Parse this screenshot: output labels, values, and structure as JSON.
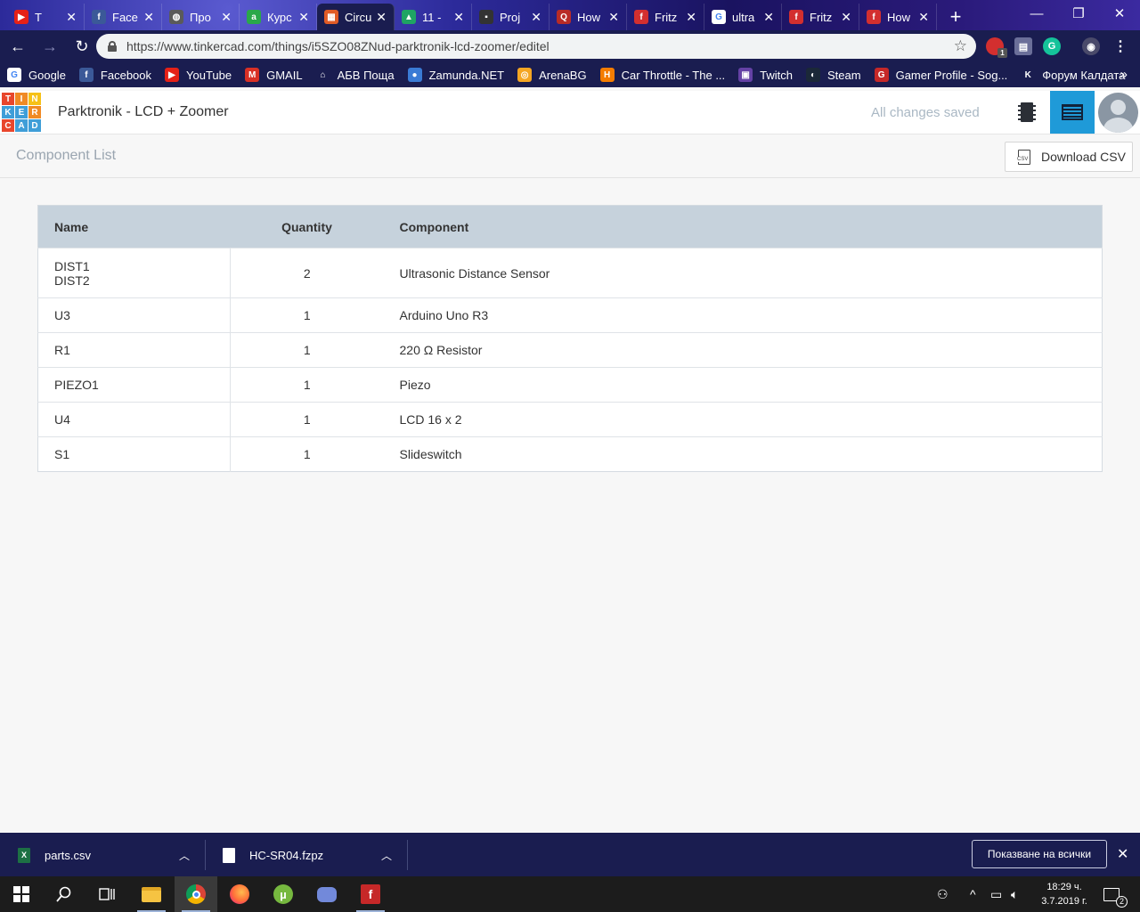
{
  "browser": {
    "tabs": [
      {
        "title": "T",
        "fav_color": "#e62117",
        "fav_glyph": "▶"
      },
      {
        "title": "Face",
        "fav_color": "#3b5998",
        "fav_glyph": "f"
      },
      {
        "title": "Про",
        "fav_color": "#5a5a5a",
        "fav_glyph": "◍"
      },
      {
        "title": "Курс",
        "fav_color": "#2aa84a",
        "fav_glyph": "a"
      },
      {
        "title": "Circu",
        "fav_color": "#e05b26",
        "fav_glyph": "▦"
      },
      {
        "title": "11 -",
        "fav_color": "#1fa463",
        "fav_glyph": "▲"
      },
      {
        "title": "Proj",
        "fav_color": "#333333",
        "fav_glyph": "▪"
      },
      {
        "title": "How",
        "fav_color": "#b92b27",
        "fav_glyph": "Q"
      },
      {
        "title": "Fritz",
        "fav_color": "#d32f2f",
        "fav_glyph": "f"
      },
      {
        "title": "ultra",
        "fav_color": "#ffffff",
        "fav_glyph": "G"
      },
      {
        "title": "Fritz",
        "fav_color": "#d32f2f",
        "fav_glyph": "f"
      },
      {
        "title": "How",
        "fav_color": "#d32f2f",
        "fav_glyph": "f"
      }
    ],
    "active_tab_index": 4,
    "url": "https://www.tinkercad.com/things/i5SZO08ZNud-parktronik-lcd-zoomer/editel",
    "extension_badge": "1",
    "bookmarks": [
      {
        "label": "Google",
        "icon": "google-icon",
        "color": "#ffffff",
        "glyph": "G"
      },
      {
        "label": "Facebook",
        "icon": "facebook-icon",
        "color": "#3b5998",
        "glyph": "f"
      },
      {
        "label": "YouTube",
        "icon": "youtube-icon",
        "color": "#e62117",
        "glyph": "▶"
      },
      {
        "label": "GMAIL",
        "icon": "gmail-icon",
        "color": "#d93025",
        "glyph": "M"
      },
      {
        "label": "АБВ Поща",
        "icon": "abv-icon",
        "color": "#1a1d50",
        "glyph": "⌂"
      },
      {
        "label": "Zamunda.NET",
        "icon": "zamunda-icon",
        "color": "#3a7bd5",
        "glyph": "●"
      },
      {
        "label": "ArenaBG",
        "icon": "arenabg-icon",
        "color": "#f5a623",
        "glyph": "◎"
      },
      {
        "label": "Car Throttle - The ...",
        "icon": "carthrottle-icon",
        "color": "#f57c00",
        "glyph": "H"
      },
      {
        "label": "Twitch",
        "icon": "twitch-icon",
        "color": "#6441a5",
        "glyph": "▣"
      },
      {
        "label": "Steam",
        "icon": "steam-icon",
        "color": "#1b2838",
        "glyph": "◐"
      },
      {
        "label": "Gamer Profile - Sog...",
        "icon": "gamerprofile-icon",
        "color": "#c62828",
        "glyph": "G"
      },
      {
        "label": "Форум Калдата",
        "icon": "kaldata-icon",
        "color": "#1a1d50",
        "glyph": "K"
      }
    ],
    "bookmarks_more": "»"
  },
  "app": {
    "logo_letters": [
      "T",
      "I",
      "N",
      "K",
      "E",
      "R",
      "C",
      "A",
      "D"
    ],
    "logo_colors": [
      "#e8462c",
      "#f08a24",
      "#f6c118",
      "#3f9ed8",
      "#3f9ed8",
      "#f08a24",
      "#e8462c",
      "#3f9ed8",
      "#3f9ed8"
    ],
    "design_title": "Parktronik - LCD + Zoomer",
    "save_status": "All changes saved",
    "accent": "#1f9ad8"
  },
  "component_list": {
    "title": "Component List",
    "download_label": "Download CSV",
    "columns": {
      "name": "Name",
      "quantity": "Quantity",
      "component": "Component"
    },
    "rows": [
      {
        "name": "DIST1",
        "name2": "DIST2",
        "quantity": "2",
        "component": "Ultrasonic Distance Sensor"
      },
      {
        "name": "U3",
        "quantity": "1",
        "component": "Arduino Uno R3"
      },
      {
        "name": "R1",
        "quantity": "1",
        "component": "220 Ω Resistor"
      },
      {
        "name": "PIEZO1",
        "quantity": "1",
        "component": "Piezo"
      },
      {
        "name": "U4",
        "quantity": "1",
        "component": "LCD 16 x 2"
      },
      {
        "name": "S1",
        "quantity": "1",
        "component": "Slideswitch"
      }
    ]
  },
  "downloads": {
    "items": [
      {
        "filename": "parts.csv",
        "icon": "excel-icon"
      },
      {
        "filename": "HC-SR04.fzpz",
        "icon": "file-icon"
      }
    ],
    "show_all_label": "Показване на всички"
  },
  "taskbar": {
    "time": "18:29 ч.",
    "date": "3.7.2019 г.",
    "notifications_count": "2"
  }
}
